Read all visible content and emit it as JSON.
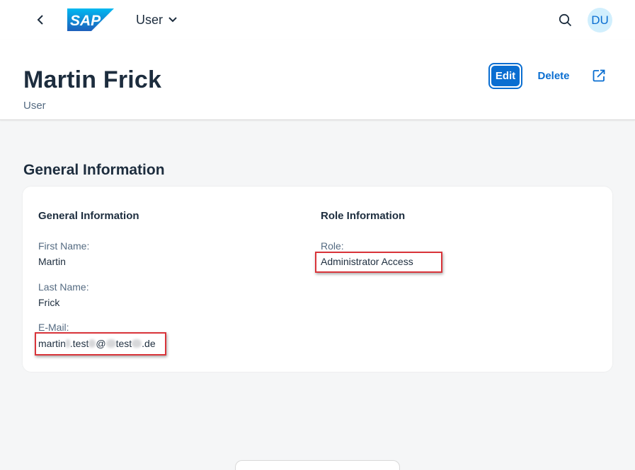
{
  "shell": {
    "logo_text": "SAP",
    "app_title": "User",
    "avatar_initials": "DU",
    "icons": [
      "back-icon",
      "chevron-down-icon",
      "search-icon"
    ]
  },
  "header": {
    "title": "Martin Frick",
    "subtitle": "User",
    "actions": {
      "edit_label": "Edit",
      "delete_label": "Delete",
      "share_icon": "share-icon"
    }
  },
  "section": {
    "title": "General Information",
    "general": {
      "title": "General Information",
      "fields": [
        {
          "label": "First Name:",
          "value": "Martin"
        },
        {
          "label": "Last Name:",
          "value": "Frick"
        },
        {
          "label": "E-Mail:",
          "value_parts": [
            "martin",
            ".test",
            "@",
            "test",
            ".de"
          ]
        }
      ]
    },
    "role": {
      "title": "Role Information",
      "label": "Role:",
      "value": "Administrator Access"
    }
  },
  "colors": {
    "brand": "#0a6ed1",
    "highlight": "#d9343a",
    "avatar_bg": "#d1effd",
    "page_bg": "#f5f6f7"
  }
}
